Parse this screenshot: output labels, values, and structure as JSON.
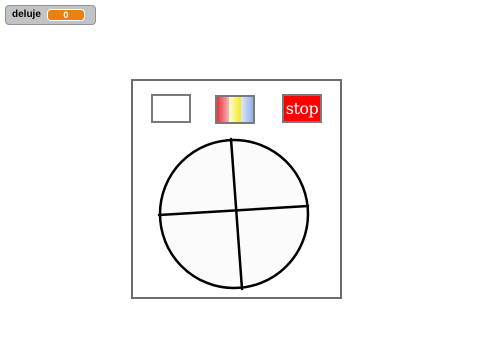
{
  "variable_monitor": {
    "label": "deluje",
    "value": "0",
    "value_color": "#ee7d16"
  },
  "controls": {
    "stop_label": "stop",
    "stop_color": "#ff0000",
    "color_stripes": [
      "#e8333b",
      "#ffffff",
      "#f3ea1b",
      "#ffffff",
      "#8fb2e8",
      "#ffffff"
    ]
  },
  "wheel": {
    "spoke_count": 4,
    "icon": "wheel-icon"
  }
}
